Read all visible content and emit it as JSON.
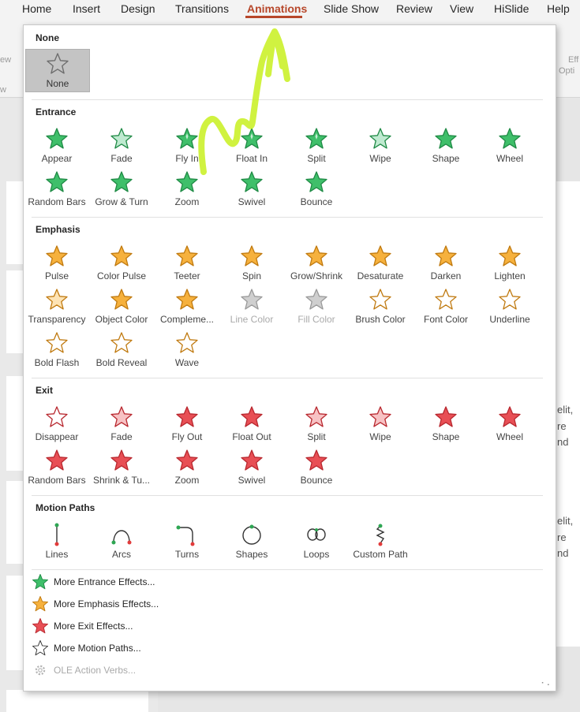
{
  "ribbon": {
    "tabs": [
      "Home",
      "Insert",
      "Design",
      "Transitions",
      "Animations",
      "Slide Show",
      "Review",
      "View",
      "HiSlide",
      "Help"
    ],
    "fragment_left_1": "ew",
    "fragment_left_2": "w",
    "fragment_right_1": "Eff",
    "fragment_right_2": "Opti"
  },
  "background": {
    "text_lines": [
      "elit,",
      "re",
      "nd",
      "elit,",
      "re",
      "nd"
    ]
  },
  "gallery": {
    "none": {
      "title": "None",
      "items": [
        {
          "label": "None",
          "icon": "none-star-icon"
        }
      ]
    },
    "entrance": {
      "title": "Entrance",
      "items": [
        {
          "label": "Appear",
          "icon": "appear-icon"
        },
        {
          "label": "Fade",
          "icon": "fade-icon"
        },
        {
          "label": "Fly In",
          "icon": "fly-in-icon"
        },
        {
          "label": "Float In",
          "icon": "float-in-icon"
        },
        {
          "label": "Split",
          "icon": "split-icon"
        },
        {
          "label": "Wipe",
          "icon": "wipe-icon"
        },
        {
          "label": "Shape",
          "icon": "shape-icon"
        },
        {
          "label": "Wheel",
          "icon": "wheel-icon"
        },
        {
          "label": "Random Bars",
          "icon": "random-bars-icon"
        },
        {
          "label": "Grow & Turn",
          "icon": "grow-turn-icon"
        },
        {
          "label": "Zoom",
          "icon": "zoom-icon"
        },
        {
          "label": "Swivel",
          "icon": "swivel-icon"
        },
        {
          "label": "Bounce",
          "icon": "bounce-icon"
        }
      ]
    },
    "emphasis": {
      "title": "Emphasis",
      "items": [
        {
          "label": "Pulse",
          "icon": "pulse-icon"
        },
        {
          "label": "Color Pulse",
          "icon": "color-pulse-icon"
        },
        {
          "label": "Teeter",
          "icon": "teeter-icon"
        },
        {
          "label": "Spin",
          "icon": "spin-icon"
        },
        {
          "label": "Grow/Shrink",
          "icon": "grow-shrink-icon"
        },
        {
          "label": "Desaturate",
          "icon": "desaturate-icon"
        },
        {
          "label": "Darken",
          "icon": "darken-icon"
        },
        {
          "label": "Lighten",
          "icon": "lighten-icon"
        },
        {
          "label": "Transparency",
          "icon": "transparency-icon"
        },
        {
          "label": "Object Color",
          "icon": "object-color-icon"
        },
        {
          "label": "Compleme...",
          "icon": "complementary-color-icon"
        },
        {
          "label": "Line Color",
          "icon": "line-color-icon",
          "disabled": true
        },
        {
          "label": "Fill Color",
          "icon": "fill-color-icon",
          "disabled": true
        },
        {
          "label": "Brush Color",
          "icon": "brush-color-icon"
        },
        {
          "label": "Font Color",
          "icon": "font-color-icon"
        },
        {
          "label": "Underline",
          "icon": "underline-icon"
        },
        {
          "label": "Bold Flash",
          "icon": "bold-flash-icon"
        },
        {
          "label": "Bold Reveal",
          "icon": "bold-reveal-icon"
        },
        {
          "label": "Wave",
          "icon": "wave-icon"
        }
      ]
    },
    "exit": {
      "title": "Exit",
      "items": [
        {
          "label": "Disappear",
          "icon": "disappear-icon"
        },
        {
          "label": "Fade",
          "icon": "exit-fade-icon"
        },
        {
          "label": "Fly Out",
          "icon": "fly-out-icon"
        },
        {
          "label": "Float Out",
          "icon": "float-out-icon"
        },
        {
          "label": "Split",
          "icon": "exit-split-icon"
        },
        {
          "label": "Wipe",
          "icon": "exit-wipe-icon"
        },
        {
          "label": "Shape",
          "icon": "exit-shape-icon"
        },
        {
          "label": "Wheel",
          "icon": "exit-wheel-icon"
        },
        {
          "label": "Random Bars",
          "icon": "exit-random-bars-icon"
        },
        {
          "label": "Shrink & Tu...",
          "icon": "shrink-turn-icon"
        },
        {
          "label": "Zoom",
          "icon": "exit-zoom-icon"
        },
        {
          "label": "Swivel",
          "icon": "exit-swivel-icon"
        },
        {
          "label": "Bounce",
          "icon": "exit-bounce-icon"
        }
      ]
    },
    "motion_paths": {
      "title": "Motion Paths",
      "items": [
        {
          "label": "Lines",
          "icon": "lines-path-icon"
        },
        {
          "label": "Arcs",
          "icon": "arcs-path-icon"
        },
        {
          "label": "Turns",
          "icon": "turns-path-icon"
        },
        {
          "label": "Shapes",
          "icon": "shapes-path-icon"
        },
        {
          "label": "Loops",
          "icon": "loops-path-icon"
        },
        {
          "label": "Custom Path",
          "icon": "custom-path-icon"
        }
      ]
    },
    "more": [
      {
        "label": "More Entrance Effects...",
        "icon": "more-entrance-icon"
      },
      {
        "label": "More Emphasis Effects...",
        "icon": "more-emphasis-icon"
      },
      {
        "label": "More Exit Effects...",
        "icon": "more-exit-icon"
      },
      {
        "label": "More Motion Paths...",
        "icon": "more-motion-paths-icon"
      },
      {
        "label": "OLE Action Verbs...",
        "icon": "ole-gear-icon",
        "disabled": true
      }
    ]
  },
  "colors": {
    "accent": "#b7472a",
    "entrance_green": "#3fbf6a",
    "emphasis_orange": "#f6b13d",
    "exit_red": "#e84f55",
    "annotation_highlighter": "#c8f01e"
  }
}
